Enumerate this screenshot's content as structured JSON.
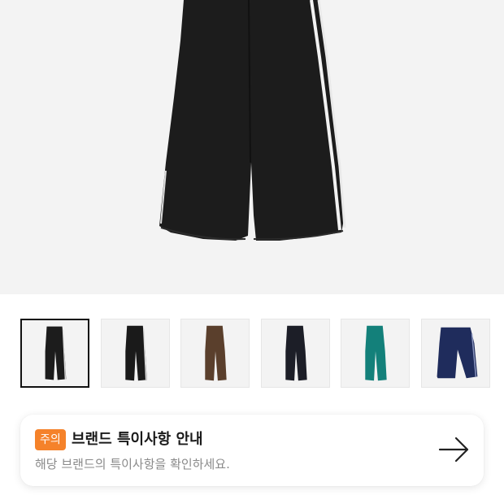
{
  "hero": {
    "image": "black-track-pants-with-white-stripes"
  },
  "thumbnails": [
    {
      "image": "black-track-pants-front",
      "selected": true,
      "color": "#1c1c1c"
    },
    {
      "image": "black-track-pants-side",
      "selected": false,
      "color": "#1a1a1a"
    },
    {
      "image": "brown-track-pants",
      "selected": false,
      "color": "#5a3f2c"
    },
    {
      "image": "navy-black-track-pants",
      "selected": false,
      "color": "#1c1e27"
    },
    {
      "image": "teal-track-pants",
      "selected": false,
      "color": "#13807a"
    },
    {
      "image": "navy-track-pants",
      "selected": false,
      "color": "#1f2c5c"
    }
  ],
  "notice": {
    "badge": "주의",
    "title": "브랜드 특이사항 안내",
    "description": "해당 브랜드의 특이사항을 확인하세요.",
    "arrow_icon": "arrow-right-icon"
  },
  "colors": {
    "badge_bg": "#f5822a",
    "hero_bg": "#f3f3f3"
  }
}
